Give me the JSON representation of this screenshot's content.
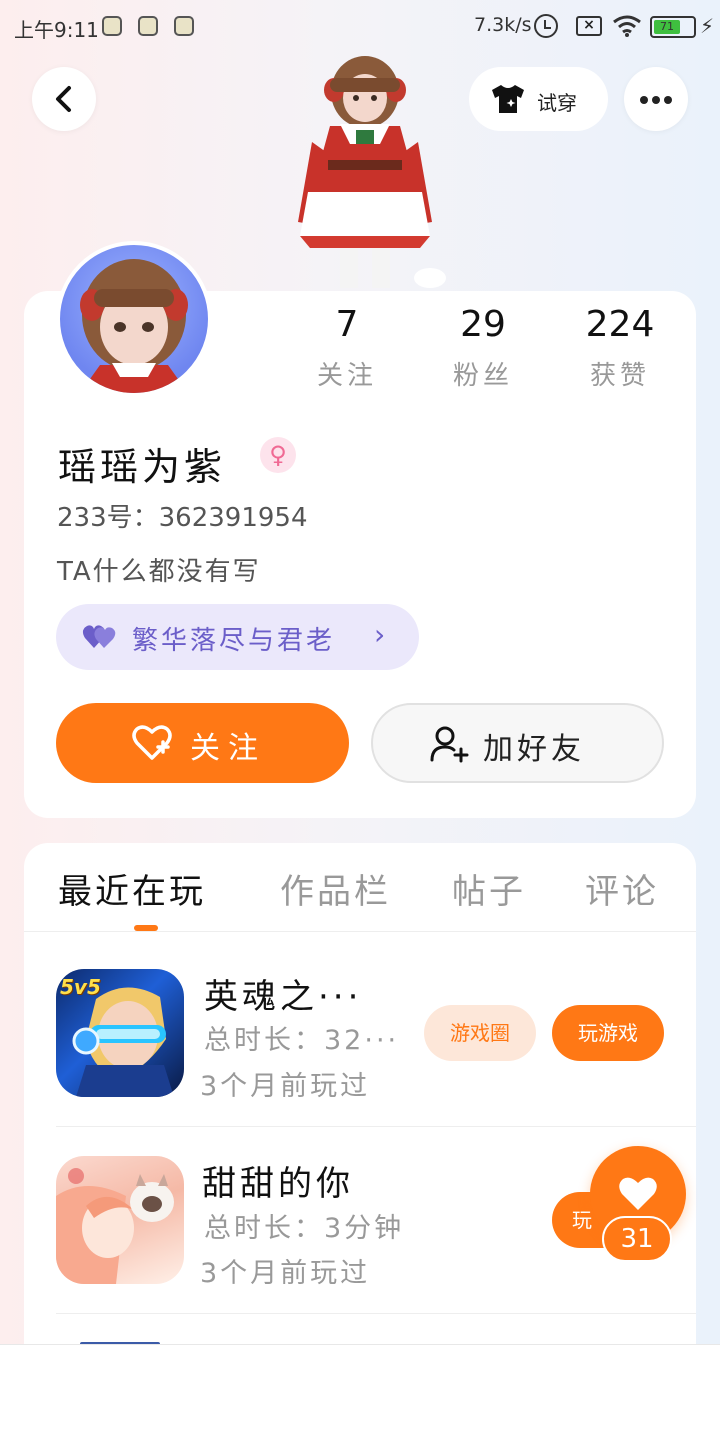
{
  "status_bar": {
    "time": "上午9:11",
    "net_speed": "7.3k/s",
    "battery": "71",
    "battery_level": 0.71
  },
  "header": {
    "try_on_label": "试穿"
  },
  "profile": {
    "stats": [
      {
        "value": "7",
        "label": "关注"
      },
      {
        "value": "29",
        "label": "粉丝"
      },
      {
        "value": "224",
        "label": "获赞"
      }
    ],
    "nickname": "瑶瑶为紫",
    "gender_symbol": "♀",
    "uid_text": "233号：362391954",
    "bio": "TA什么都没有写",
    "tag_text": "繁华落尽与君老",
    "tag_chevron": "›",
    "follow_label": "关注",
    "add_friend_label": "加好友"
  },
  "tabs": [
    "最近在玩",
    "作品栏",
    "帖子",
    "评论"
  ],
  "games": [
    {
      "title": "英魂之···",
      "total_time": "总时长：32···",
      "last_played": "3个月前玩过",
      "circle_label": "游戏圈",
      "play_label": "玩游戏",
      "icon_badge": "5v5"
    },
    {
      "title": "甜甜的你",
      "total_time": "总时长：3分钟",
      "last_played": "3个月前玩过",
      "play_label": "玩"
    }
  ],
  "like_fab": {
    "count": "31"
  },
  "colors": {
    "accent": "#ff7815",
    "tag_bg": "#ebe8fb",
    "tag_text": "#6b5ec9"
  }
}
